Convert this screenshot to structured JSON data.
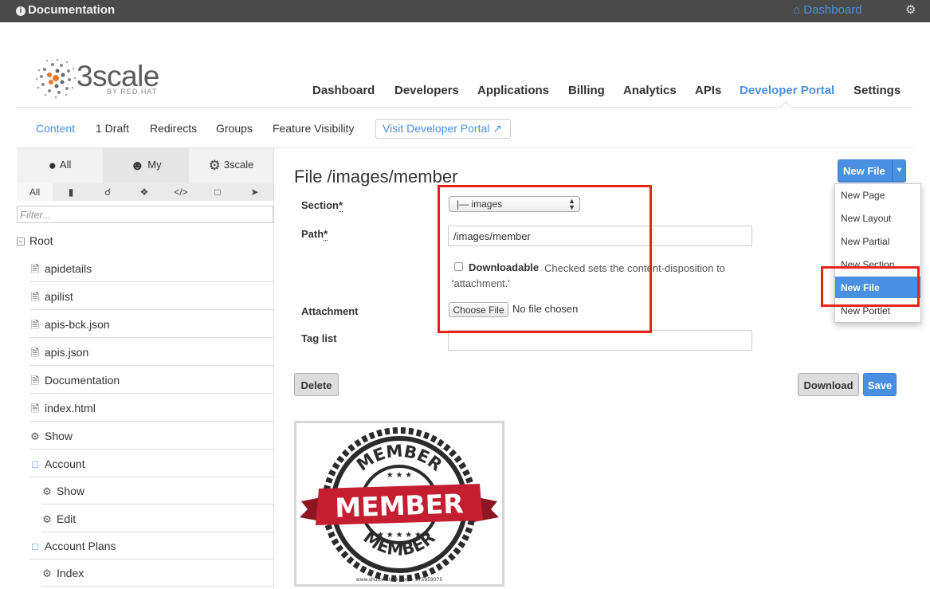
{
  "topbar": {
    "title": "Documentation",
    "dashboard_link": "Dashboard"
  },
  "brand": {
    "name": "3scale",
    "byline": "BY RED HAT"
  },
  "main_nav": [
    {
      "label": "Dashboard"
    },
    {
      "label": "Developers"
    },
    {
      "label": "Applications"
    },
    {
      "label": "Billing"
    },
    {
      "label": "Analytics"
    },
    {
      "label": "APIs"
    },
    {
      "label": "Developer Portal",
      "active": true
    },
    {
      "label": "Settings"
    }
  ],
  "sub_nav": {
    "items": [
      "Content",
      "1 Draft",
      "Redirects",
      "Groups",
      "Feature Visibility"
    ],
    "active": "Content",
    "visit_button": "Visit Developer Portal"
  },
  "sidebar": {
    "scope_tabs": [
      "All",
      "My",
      "3scale"
    ],
    "selected_scope": "My",
    "type_tabs": [
      "All",
      "page-icon",
      "attachment-icon",
      "puzzle-icon",
      "code-icon",
      "folder-icon",
      "rocket-icon"
    ],
    "filter_placeholder": "Filter...",
    "root_label": "Root",
    "items": [
      {
        "label": "apidetails",
        "icon": "file-icon"
      },
      {
        "label": "apilist",
        "icon": "file-icon"
      },
      {
        "label": "apis-bck.json",
        "icon": "file-icon"
      },
      {
        "label": "apis.json",
        "icon": "file-icon"
      },
      {
        "label": "Documentation",
        "icon": "file-icon"
      },
      {
        "label": "index.html",
        "icon": "file-icon"
      },
      {
        "label": "Show",
        "icon": "gear-icon"
      },
      {
        "label": "Account",
        "icon": "folder-open-icon"
      },
      {
        "label": "Show",
        "icon": "gear-icon"
      },
      {
        "label": "Edit",
        "icon": "gear-icon"
      },
      {
        "label": "Account Plans",
        "icon": "folder-open-icon"
      },
      {
        "label": "Index",
        "icon": "gear-icon"
      }
    ]
  },
  "form": {
    "title": "File /images/member",
    "section_label": "Section",
    "section_value": "|— images",
    "path_label": "Path",
    "path_value": "/images/member",
    "downloadable_label": "Downloadable",
    "downloadable_hint": "Checked sets the content-disposition to 'attachment.'",
    "downloadable_checked": false,
    "attachment_label": "Attachment",
    "choose_file_label": "Choose File",
    "no_file_text": "No file chosen",
    "tag_list_label": "Tag list",
    "tag_list_value": "",
    "required_mark": "*"
  },
  "actions": {
    "delete": "Delete",
    "download": "Download",
    "save": "Save"
  },
  "new_file_button": "New File",
  "dropdown": {
    "items": [
      "New Page",
      "New Layout",
      "New Partial",
      "New Section",
      "New File",
      "New Portlet"
    ],
    "active": "New File"
  },
  "preview": {
    "badge_top": "MEMBER",
    "badge_ribbon": "MEMBER",
    "badge_bottom": "MEMBER",
    "watermark": "www.shutterstock.com · 575959075"
  },
  "colors": {
    "accent": "#4a90e2",
    "highlight_box": "#e8231a",
    "topbar": "#4a4a4a",
    "ribbon": "#c41e30"
  }
}
